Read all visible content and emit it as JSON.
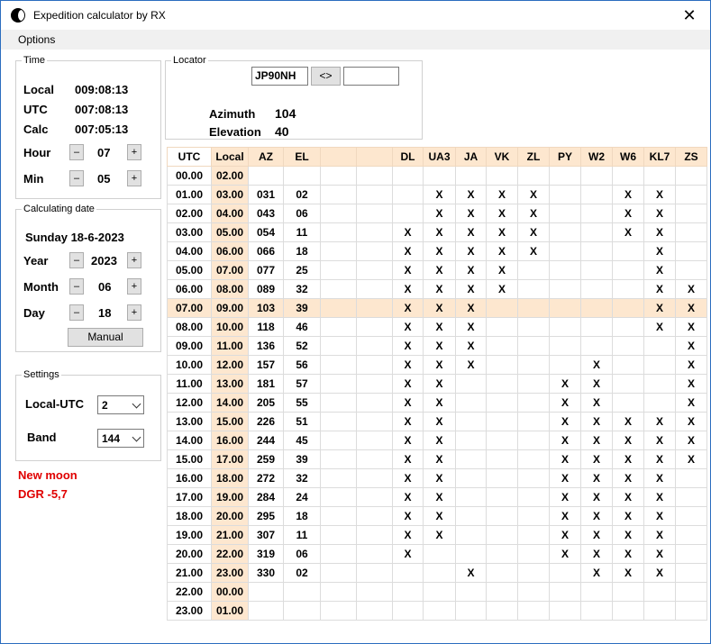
{
  "window": {
    "title": "Expedition calculator by RX",
    "close": "✕"
  },
  "menu": {
    "options": "Options"
  },
  "time": {
    "legend": "Time",
    "local_label": "Local",
    "local_value": "009:08:13",
    "utc_label": "UTC",
    "utc_value": "007:08:13",
    "calc_label": "Calc",
    "calc_value": "007:05:13",
    "hour_label": "Hour",
    "hour_value": "07",
    "min_label": "Min",
    "min_value": "05",
    "minus": "–",
    "plus": "+"
  },
  "calc_date": {
    "legend": "Calculating date",
    "date_text": "Sunday 18-6-2023",
    "year_label": "Year",
    "year_value": "2023",
    "month_label": "Month",
    "month_value": "06",
    "day_label": "Day",
    "day_value": "18",
    "manual_label": "Manual"
  },
  "settings": {
    "legend": "Settings",
    "local_utc_label": "Local-UTC",
    "local_utc_value": "2",
    "band_label": "Band",
    "band_value": "144"
  },
  "status": {
    "moon": "New moon",
    "dgr": "DGR -5,7"
  },
  "locator": {
    "legend": "Locator",
    "value": "JP90NH",
    "swap_label": "<>",
    "other_value": "",
    "azimuth_label": "Azimuth",
    "azimuth_value": "104",
    "elevation_label": "Elevation",
    "elevation_value": "40"
  },
  "table": {
    "headers": [
      "UTC",
      "Local",
      "AZ",
      "EL",
      "",
      "",
      "DL",
      "UA3",
      "JA",
      "VK",
      "ZL",
      "PY",
      "W2",
      "W6",
      "KL7",
      "ZS"
    ],
    "highlight_row": 7,
    "rows": [
      [
        "00.00",
        "02.00",
        "",
        "",
        "",
        "",
        "",
        "",
        "",
        "",
        "",
        "",
        "",
        "",
        "",
        ""
      ],
      [
        "01.00",
        "03.00",
        "031",
        "02",
        "",
        "",
        "",
        "X",
        "X",
        "X",
        "X",
        "",
        "",
        "X",
        "X",
        ""
      ],
      [
        "02.00",
        "04.00",
        "043",
        "06",
        "",
        "",
        "",
        "X",
        "X",
        "X",
        "X",
        "",
        "",
        "X",
        "X",
        ""
      ],
      [
        "03.00",
        "05.00",
        "054",
        "11",
        "",
        "",
        "X",
        "X",
        "X",
        "X",
        "X",
        "",
        "",
        "X",
        "X",
        ""
      ],
      [
        "04.00",
        "06.00",
        "066",
        "18",
        "",
        "",
        "X",
        "X",
        "X",
        "X",
        "X",
        "",
        "",
        "",
        "X",
        ""
      ],
      [
        "05.00",
        "07.00",
        "077",
        "25",
        "",
        "",
        "X",
        "X",
        "X",
        "X",
        "",
        "",
        "",
        "",
        "X",
        ""
      ],
      [
        "06.00",
        "08.00",
        "089",
        "32",
        "",
        "",
        "X",
        "X",
        "X",
        "X",
        "",
        "",
        "",
        "",
        "X",
        "X"
      ],
      [
        "07.00",
        "09.00",
        "103",
        "39",
        "",
        "",
        "X",
        "X",
        "X",
        "",
        "",
        "",
        "",
        "",
        "X",
        "X"
      ],
      [
        "08.00",
        "10.00",
        "118",
        "46",
        "",
        "",
        "X",
        "X",
        "X",
        "",
        "",
        "",
        "",
        "",
        "X",
        "X"
      ],
      [
        "09.00",
        "11.00",
        "136",
        "52",
        "",
        "",
        "X",
        "X",
        "X",
        "",
        "",
        "",
        "",
        "",
        "",
        "X"
      ],
      [
        "10.00",
        "12.00",
        "157",
        "56",
        "",
        "",
        "X",
        "X",
        "X",
        "",
        "",
        "",
        "X",
        "",
        "",
        "X"
      ],
      [
        "11.00",
        "13.00",
        "181",
        "57",
        "",
        "",
        "X",
        "X",
        "",
        "",
        "",
        "X",
        "X",
        "",
        "",
        "X"
      ],
      [
        "12.00",
        "14.00",
        "205",
        "55",
        "",
        "",
        "X",
        "X",
        "",
        "",
        "",
        "X",
        "X",
        "",
        "",
        "X"
      ],
      [
        "13.00",
        "15.00",
        "226",
        "51",
        "",
        "",
        "X",
        "X",
        "",
        "",
        "",
        "X",
        "X",
        "X",
        "X",
        "X"
      ],
      [
        "14.00",
        "16.00",
        "244",
        "45",
        "",
        "",
        "X",
        "X",
        "",
        "",
        "",
        "X",
        "X",
        "X",
        "X",
        "X"
      ],
      [
        "15.00",
        "17.00",
        "259",
        "39",
        "",
        "",
        "X",
        "X",
        "",
        "",
        "",
        "X",
        "X",
        "X",
        "X",
        "X"
      ],
      [
        "16.00",
        "18.00",
        "272",
        "32",
        "",
        "",
        "X",
        "X",
        "",
        "",
        "",
        "X",
        "X",
        "X",
        "X",
        ""
      ],
      [
        "17.00",
        "19.00",
        "284",
        "24",
        "",
        "",
        "X",
        "X",
        "",
        "",
        "",
        "X",
        "X",
        "X",
        "X",
        ""
      ],
      [
        "18.00",
        "20.00",
        "295",
        "18",
        "",
        "",
        "X",
        "X",
        "",
        "",
        "",
        "X",
        "X",
        "X",
        "X",
        ""
      ],
      [
        "19.00",
        "21.00",
        "307",
        "11",
        "",
        "",
        "X",
        "X",
        "",
        "",
        "",
        "X",
        "X",
        "X",
        "X",
        ""
      ],
      [
        "20.00",
        "22.00",
        "319",
        "06",
        "",
        "",
        "X",
        "",
        "",
        "",
        "",
        "X",
        "X",
        "X",
        "X",
        ""
      ],
      [
        "21.00",
        "23.00",
        "330",
        "02",
        "",
        "",
        "",
        "",
        "X",
        "",
        "",
        "",
        "X",
        "X",
        "X",
        ""
      ],
      [
        "22.00",
        "00.00",
        "",
        "",
        "",
        "",
        "",
        "",
        "",
        "",
        "",
        "",
        "",
        "",
        "",
        ""
      ],
      [
        "23.00",
        "01.00",
        "",
        "",
        "",
        "",
        "",
        "",
        "",
        "",
        "",
        "",
        "",
        "",
        "",
        ""
      ]
    ]
  }
}
